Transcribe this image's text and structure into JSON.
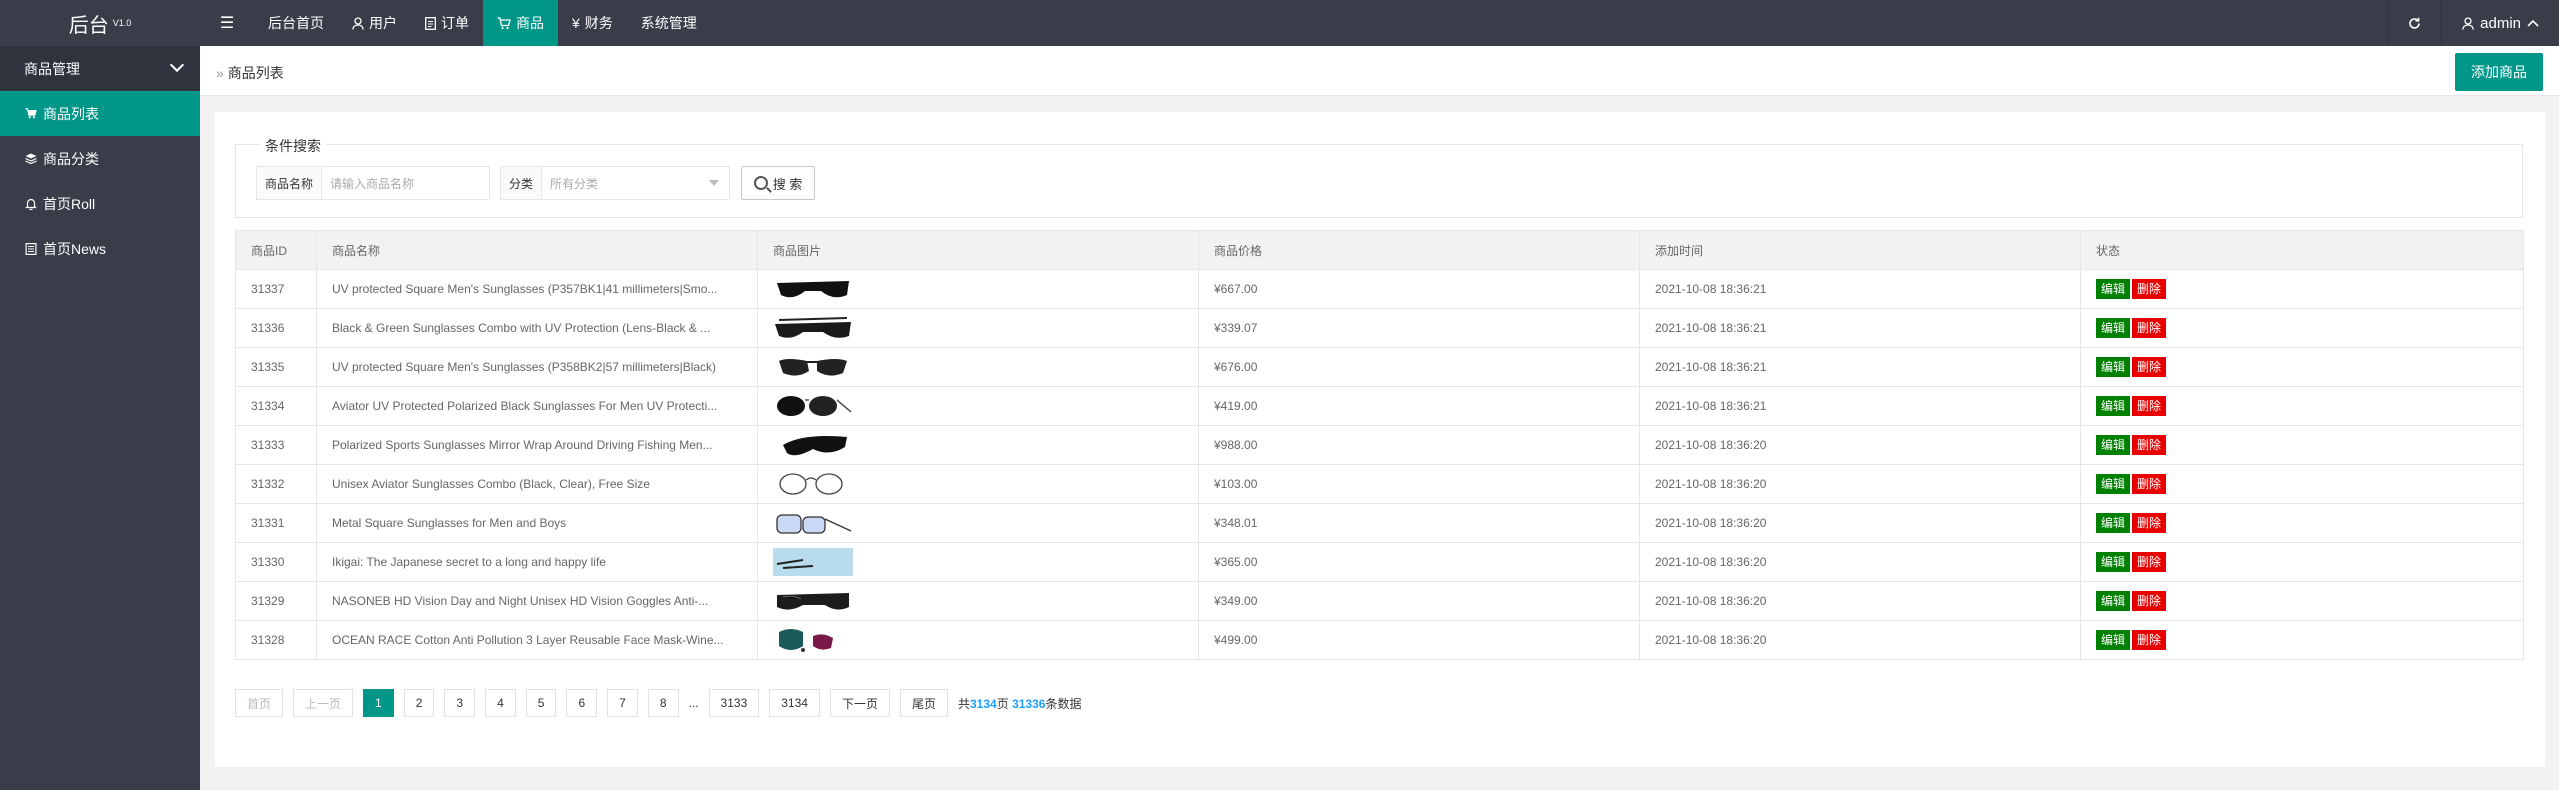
{
  "header": {
    "logo": "后台",
    "version": "V1.0",
    "nav": [
      {
        "label": "后台首页",
        "icon": ""
      },
      {
        "label": "用户",
        "icon": "user-icon"
      },
      {
        "label": "订单",
        "icon": "document-icon"
      },
      {
        "label": "商品",
        "icon": "cart-icon"
      },
      {
        "label": "财务",
        "icon": "yen-icon"
      },
      {
        "label": "系统管理",
        "icon": ""
      }
    ],
    "user": "admin"
  },
  "sidebar": {
    "group": "商品管理",
    "items": [
      {
        "label": "商品列表",
        "icon": "cart-icon"
      },
      {
        "label": "商品分类",
        "icon": "layers-icon"
      },
      {
        "label": "首页Roll",
        "icon": "bell-icon"
      },
      {
        "label": "首页News",
        "icon": "news-icon"
      }
    ]
  },
  "topbar": {
    "breadcrumb": "商品列表",
    "add_button": "添加商品"
  },
  "search": {
    "legend": "条件搜索",
    "name_label": "商品名称",
    "name_placeholder": "请输入商品名称",
    "category_label": "分类",
    "category_placeholder": "所有分类",
    "button": "搜 索"
  },
  "table": {
    "headers": [
      "商品ID",
      "商品名称",
      "商品图片",
      "商品价格",
      "添加时间",
      "状态"
    ],
    "edit_label": "编辑",
    "delete_label": "删除",
    "rows": [
      {
        "id": "31337",
        "name": "UV protected Square Men's Sunglasses (P357BK1|41 millimeters|Smo...",
        "price": "¥667.00",
        "time": "2021-10-08 18:36:21"
      },
      {
        "id": "31336",
        "name": "Black & Green Sunglasses Combo with UV Protection (Lens-Black & ...",
        "price": "¥339.07",
        "time": "2021-10-08 18:36:21"
      },
      {
        "id": "31335",
        "name": "UV protected Square Men's Sunglasses (P358BK2|57 millimeters|Black)",
        "price": "¥676.00",
        "time": "2021-10-08 18:36:21"
      },
      {
        "id": "31334",
        "name": "Aviator UV Protected Polarized Black Sunglasses For Men UV Protecti...",
        "price": "¥419.00",
        "time": "2021-10-08 18:36:21"
      },
      {
        "id": "31333",
        "name": "Polarized Sports Sunglasses Mirror Wrap Around Driving Fishing Men...",
        "price": "¥988.00",
        "time": "2021-10-08 18:36:20"
      },
      {
        "id": "31332",
        "name": "Unisex Aviator Sunglasses Combo (Black, Clear), Free Size",
        "price": "¥103.00",
        "time": "2021-10-08 18:36:20"
      },
      {
        "id": "31331",
        "name": "Metal Square Sunglasses for Men and Boys",
        "price": "¥348.01",
        "time": "2021-10-08 18:36:20"
      },
      {
        "id": "31330",
        "name": "Ikigai: The Japanese secret to a long and happy life",
        "price": "¥365.00",
        "time": "2021-10-08 18:36:20"
      },
      {
        "id": "31329",
        "name": "NASONEB HD Vision Day and Night Unisex HD Vision Goggles Anti-...",
        "price": "¥349.00",
        "time": "2021-10-08 18:36:20"
      },
      {
        "id": "31328",
        "name": "OCEAN RACE Cotton Anti Pollution 3 Layer Reusable Face Mask-Wine...",
        "price": "¥499.00",
        "time": "2021-10-08 18:36:20"
      }
    ]
  },
  "pager": {
    "first": "首页",
    "prev": "上一页",
    "pages": [
      "1",
      "2",
      "3",
      "4",
      "5",
      "6",
      "7",
      "8"
    ],
    "ellipsis": "...",
    "last_pages": [
      "3133",
      "3134"
    ],
    "next": "下一页",
    "last": "尾页",
    "total_prefix": "共",
    "total_pages": "3134",
    "total_mid": "页",
    "total_records": "31336",
    "total_suffix": "条数据"
  },
  "colors": {
    "accent": "#009688",
    "header": "#393d49",
    "edit": "#008000",
    "delete": "#e80000"
  }
}
